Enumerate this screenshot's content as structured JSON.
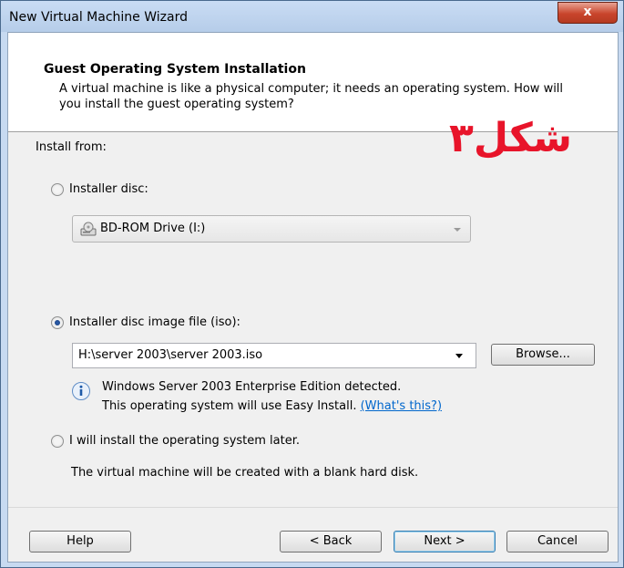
{
  "window": {
    "title": "New Virtual Machine Wizard",
    "close_label": "x"
  },
  "header": {
    "title": "Guest Operating System Installation",
    "description": "A virtual machine is like a physical computer; it needs an operating system. How will you install the guest operating system?"
  },
  "install_from_label": "Install from:",
  "options": {
    "disc": {
      "label": "Installer disc:",
      "selected": false,
      "drive_value": "BD-ROM Drive (I:)"
    },
    "iso": {
      "label": "Installer disc image file (iso):",
      "selected": true,
      "path_value": "H:\\server 2003\\server 2003.iso",
      "browse_label": "Browse...",
      "detected_line1": "Windows Server 2003 Enterprise Edition detected.",
      "detected_line2": "This operating system will use Easy Install.",
      "whats_this": "(What's this?)"
    },
    "later": {
      "label": "I will install the operating system later.",
      "selected": false,
      "note": "The virtual machine will be created with a blank hard disk."
    }
  },
  "buttons": {
    "help": "Help",
    "back": "< Back",
    "next": "Next >",
    "cancel": "Cancel"
  },
  "overlay_caption": "شکل۳",
  "colors": {
    "overlay": "#e8142a",
    "link": "#0066cc",
    "accent": "#3c7fb1"
  }
}
